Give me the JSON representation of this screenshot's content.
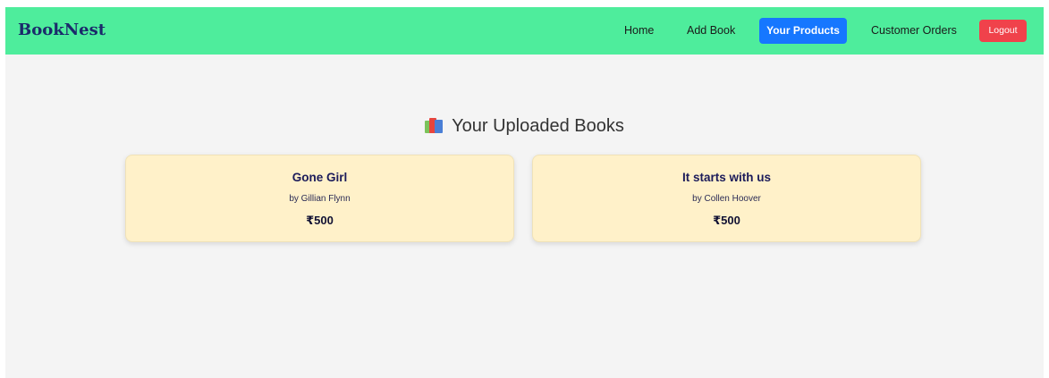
{
  "navbar": {
    "brand": "BookNest",
    "links": [
      {
        "label": "Home"
      },
      {
        "label": "Add Book"
      },
      {
        "label": "Your Products",
        "active": true
      },
      {
        "label": "Customer Orders"
      }
    ],
    "logout_label": "Logout",
    "colors": {
      "background": "#4eed9c",
      "active": "#1677ff",
      "logout": "#f0424b",
      "brand": "#1b2a6b"
    }
  },
  "main": {
    "heading": "Your Uploaded Books",
    "heading_icon": "books-icon",
    "books": [
      {
        "title": "Gone Girl",
        "author": "by Gillian Flynn",
        "price": "₹500"
      },
      {
        "title": "It starts with us",
        "author": "by Collen Hoover",
        "price": "₹500"
      }
    ],
    "card_color": "#fff1c9"
  }
}
